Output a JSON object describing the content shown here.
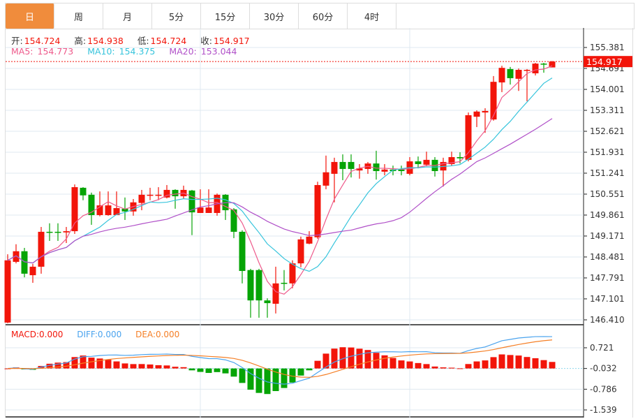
{
  "tabs": [
    {
      "label": "日",
      "active": true
    },
    {
      "label": "周"
    },
    {
      "label": "月"
    },
    {
      "label": "5分"
    },
    {
      "label": "15分"
    },
    {
      "label": "30分"
    },
    {
      "label": "60分"
    },
    {
      "label": "4时"
    }
  ],
  "ohlc": {
    "open_label": "开:",
    "open": "154.724",
    "high_label": "高:",
    "high": "154.938",
    "low_label": "低:",
    "low": "154.724",
    "close_label": "收:",
    "close": "154.917"
  },
  "ma": {
    "ma5_label": "MA5:",
    "ma5": "154.773",
    "ma10_label": "MA10:",
    "ma10": "154.375",
    "ma20_label": "MA20:",
    "ma20": "153.044"
  },
  "macd_legend": {
    "macd": "MACD:0.000",
    "diff": "DIFF:0.000",
    "dea": "DEA:0.000"
  },
  "current_price": "154.917",
  "colors": {
    "up": "#f2150a",
    "down": "#06a406",
    "ma5": "#ee5a8b",
    "ma10": "#36c4dc",
    "ma20": "#b050c8",
    "diff": "#4aa3ee",
    "dea": "#f57f26",
    "accent": "#f08c3c"
  },
  "chart_data": {
    "type": "candlestick",
    "price_axis": {
      "ticks": [
        "155.381",
        "154.691",
        "154.001",
        "153.311",
        "152.621",
        "151.931",
        "151.241",
        "150.551",
        "149.861",
        "149.171",
        "148.481",
        "147.791",
        "147.101",
        "146.410"
      ],
      "ylim": [
        146.41,
        155.381
      ]
    },
    "macd_axis": {
      "ticks": [
        "0.721",
        "-0.032",
        "-0.786",
        "-1.539"
      ],
      "ylim": [
        -1.539,
        0.721
      ]
    },
    "candles": [
      [
        146.32,
        148.57,
        146.3,
        148.37
      ],
      [
        148.32,
        148.9,
        148.27,
        148.67
      ],
      [
        148.67,
        148.78,
        147.81,
        147.93
      ],
      [
        147.88,
        148.25,
        147.63,
        148.16
      ],
      [
        148.16,
        149.47,
        147.93,
        149.31
      ],
      [
        149.31,
        149.59,
        149.01,
        149.29
      ],
      [
        149.31,
        149.59,
        149.01,
        149.29
      ],
      [
        149.29,
        149.47,
        148.94,
        149.33
      ],
      [
        149.33,
        150.87,
        149.24,
        150.78
      ],
      [
        150.76,
        150.78,
        150.35,
        150.51
      ],
      [
        150.53,
        150.6,
        149.54,
        149.86
      ],
      [
        149.86,
        150.64,
        149.82,
        150.18
      ],
      [
        149.86,
        150.64,
        149.84,
        150.18
      ],
      [
        149.86,
        150.64,
        149.86,
        150.09
      ],
      [
        150.07,
        150.44,
        149.7,
        149.98
      ],
      [
        149.98,
        150.39,
        149.84,
        150.28
      ],
      [
        150.26,
        150.69,
        150.02,
        150.53
      ],
      [
        150.51,
        150.76,
        150.35,
        150.53
      ],
      [
        150.51,
        150.78,
        150.35,
        150.53
      ],
      [
        150.44,
        150.85,
        150.41,
        150.69
      ],
      [
        150.69,
        150.71,
        150.07,
        150.48
      ],
      [
        150.48,
        150.83,
        150.41,
        150.69
      ],
      [
        150.67,
        150.69,
        149.2,
        149.95
      ],
      [
        149.93,
        150.71,
        149.93,
        150.11
      ],
      [
        149.93,
        150.71,
        149.93,
        150.11
      ],
      [
        149.93,
        150.57,
        149.84,
        150.53
      ],
      [
        150.53,
        150.55,
        149.7,
        150.02
      ],
      [
        150.05,
        150.09,
        149.1,
        149.31
      ],
      [
        149.31,
        149.36,
        147.61,
        148.02
      ],
      [
        148.05,
        148.09,
        146.48,
        147.05
      ],
      [
        148.05,
        148.09,
        146.48,
        147.05
      ],
      [
        147.05,
        147.12,
        146.48,
        146.96
      ],
      [
        146.94,
        148.16,
        146.62,
        147.61
      ],
      [
        147.63,
        148.05,
        147.38,
        147.61
      ],
      [
        147.61,
        148.37,
        147.45,
        148.27
      ],
      [
        148.27,
        149.15,
        148.14,
        149.06
      ],
      [
        148.92,
        149.33,
        148.9,
        149.15
      ],
      [
        149.13,
        150.96,
        149.08,
        150.85
      ],
      [
        150.83,
        151.82,
        150.71,
        151.27
      ],
      [
        151.22,
        151.75,
        150.28,
        151.61
      ],
      [
        151.61,
        151.86,
        151.01,
        151.38
      ],
      [
        151.61,
        151.86,
        151.1,
        151.38
      ],
      [
        151.33,
        151.54,
        151.06,
        151.4
      ],
      [
        151.38,
        151.61,
        151.22,
        151.56
      ],
      [
        151.56,
        151.98,
        151.03,
        151.31
      ],
      [
        151.29,
        151.54,
        151.17,
        151.36
      ],
      [
        151.36,
        151.49,
        151.17,
        151.31
      ],
      [
        151.36,
        151.49,
        151.17,
        151.31
      ],
      [
        151.22,
        151.77,
        151.17,
        151.63
      ],
      [
        151.63,
        151.79,
        151.4,
        151.54
      ],
      [
        151.52,
        151.95,
        151.47,
        151.68
      ],
      [
        151.68,
        151.77,
        151.13,
        151.31
      ],
      [
        151.33,
        151.75,
        150.8,
        151.61
      ],
      [
        151.54,
        151.95,
        151.49,
        151.77
      ],
      [
        151.77,
        151.93,
        151.56,
        151.73
      ],
      [
        151.68,
        153.24,
        151.63,
        153.15
      ],
      [
        153.1,
        153.31,
        152.76,
        153.27
      ],
      [
        153.24,
        153.38,
        152.57,
        153.29
      ],
      [
        153.01,
        154.44,
        152.97,
        154.25
      ],
      [
        154.23,
        154.78,
        153.91,
        154.71
      ],
      [
        154.67,
        154.74,
        154.16,
        154.37
      ],
      [
        154.35,
        154.69,
        153.95,
        154.645
      ],
      [
        154.62,
        154.67,
        153.61,
        154.645
      ],
      [
        154.53,
        154.875,
        154.46,
        154.85
      ],
      [
        154.85,
        154.875,
        154.55,
        154.83
      ],
      [
        154.724,
        154.938,
        154.724,
        154.917
      ]
    ],
    "candle_format": [
      "open",
      "high",
      "low",
      "close"
    ],
    "indicators": [
      "MA5",
      "MA10",
      "MA20",
      "MACD(12,26,9)"
    ]
  }
}
